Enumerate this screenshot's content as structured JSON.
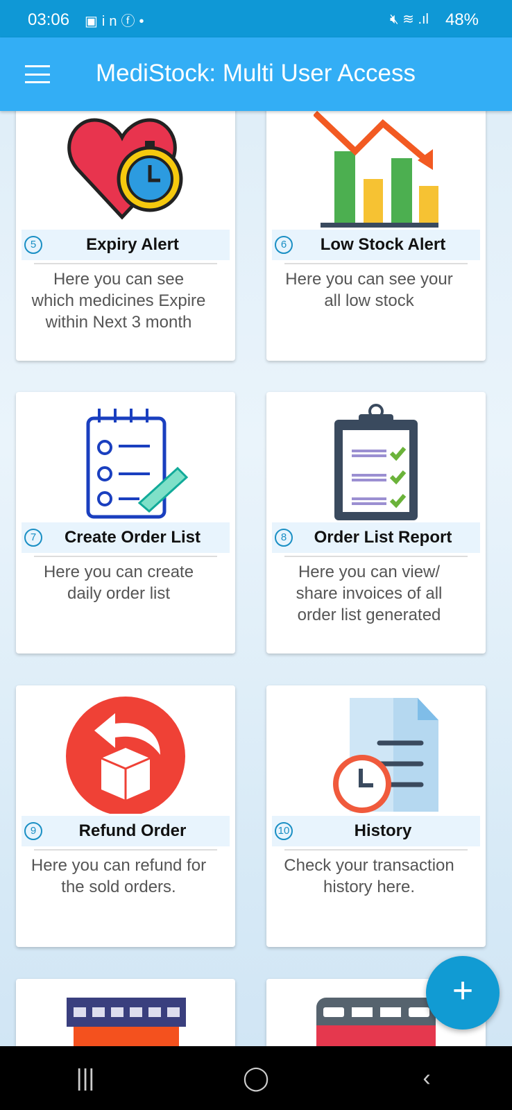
{
  "status_bar": {
    "time": "03:06",
    "notification_icons": [
      "gallery-icon",
      "linkedin-icon",
      "facebook-icon",
      "dot-icon"
    ],
    "battery": "48%"
  },
  "app_bar": {
    "title": "MediStock: Multi User Access"
  },
  "cards": [
    {
      "number": "5",
      "title": "Expiry Alert",
      "description": "Here you can see which medicines Expire within Next 3 month",
      "icon": "heart-stopwatch-icon"
    },
    {
      "number": "6",
      "title": "Low Stock Alert",
      "description": "Here you can see your all low stock",
      "icon": "declining-chart-icon"
    },
    {
      "number": "7",
      "title": "Create Order List",
      "description": "Here you can create daily order list",
      "icon": "notepad-checklist-icon"
    },
    {
      "number": "8",
      "title": "Order List Report",
      "description": "Here you can view/ share invoices of all order list generated",
      "icon": "clipboard-icon"
    },
    {
      "number": "9",
      "title": "Refund Order",
      "description": "Here you can refund for the sold orders.",
      "icon": "refund-box-icon"
    },
    {
      "number": "10",
      "title": "History",
      "description": "Check your transaction history here.",
      "icon": "document-clock-icon"
    }
  ],
  "fab": {
    "label": "+"
  },
  "colors": {
    "status_bar": "#0f98d6",
    "app_bar": "#33aef5",
    "fab": "#119bd3"
  }
}
